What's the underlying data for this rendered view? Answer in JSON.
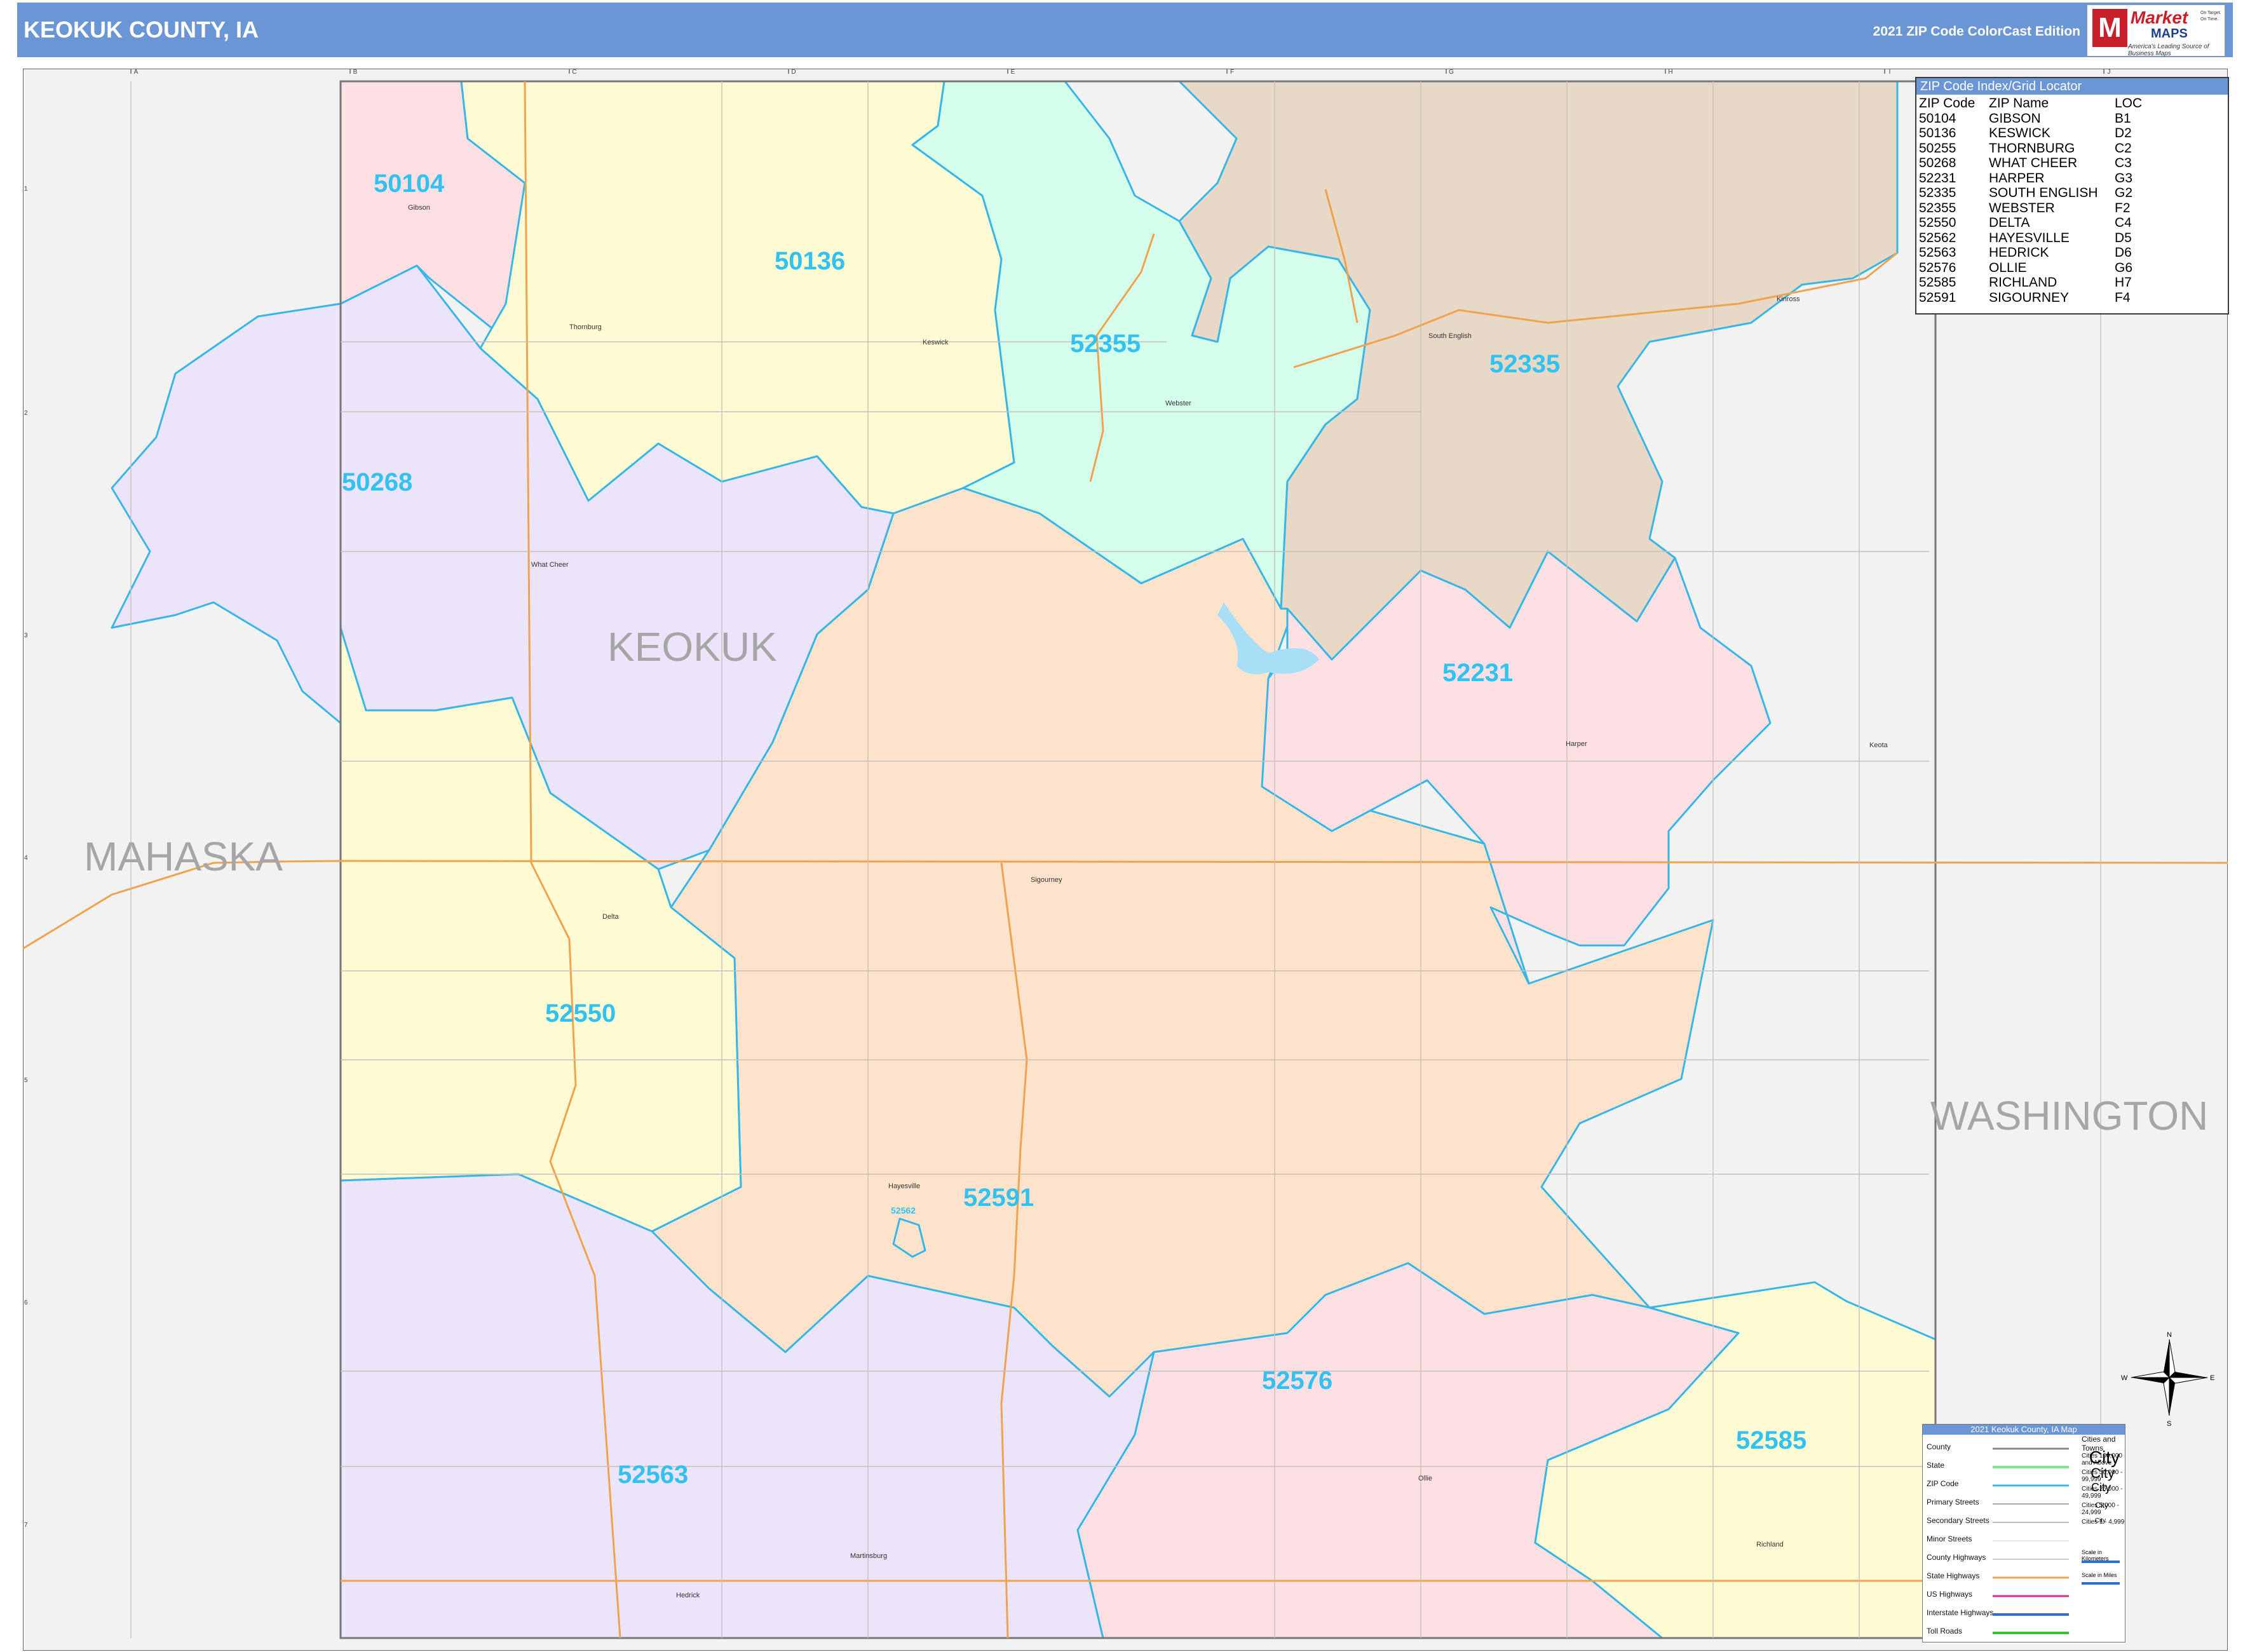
{
  "header": {
    "title": "KEOKUK COUNTY, IA",
    "edition": "2021 ZIP Code ColorCast Edition"
  },
  "logo": {
    "brand_line1": "Market",
    "brand_line2": "MAPS",
    "tagline": "America's Leading Source of Business Maps",
    "slogan": "On Target. On Time."
  },
  "county_labels": {
    "keokuk": "KEOKUK",
    "mahaska": "MAHASKA",
    "washington": "WASHINGTON"
  },
  "zip_labels": [
    "50104",
    "50136",
    "52355",
    "52335",
    "50268",
    "52231",
    "52550",
    "52591",
    "52576",
    "52585",
    "52563",
    "52562"
  ],
  "towns": [
    "Gibson",
    "Thornburg",
    "Keswick",
    "Webster",
    "South English",
    "Kinross",
    "What Cheer",
    "Harper",
    "Keota",
    "Sigourney",
    "Delta",
    "Hayesville",
    "Ollie",
    "Richland",
    "Hedrick",
    "Martinsburg"
  ],
  "grid": {
    "columns": [
      "A",
      "B",
      "C",
      "D",
      "E",
      "F",
      "G",
      "H",
      "I",
      "J"
    ],
    "rows": [
      "1",
      "2",
      "3",
      "4",
      "5",
      "6",
      "7"
    ]
  },
  "index": {
    "heading": "ZIP Code Index/Grid Locator",
    "columns": [
      "ZIP Code",
      "ZIP Name",
      "LOC"
    ],
    "rows": [
      [
        "50104",
        "GIBSON",
        "B1"
      ],
      [
        "50136",
        "KESWICK",
        "D2"
      ],
      [
        "50255",
        "THORNBURG",
        "C2"
      ],
      [
        "50268",
        "WHAT CHEER",
        "C3"
      ],
      [
        "52231",
        "HARPER",
        "G3"
      ],
      [
        "52335",
        "SOUTH ENGLISH",
        "G2"
      ],
      [
        "52355",
        "WEBSTER",
        "F2"
      ],
      [
        "52550",
        "DELTA",
        "C4"
      ],
      [
        "52562",
        "HAYESVILLE",
        "D5"
      ],
      [
        "52563",
        "HEDRICK",
        "D6"
      ],
      [
        "52576",
        "OLLIE",
        "G6"
      ],
      [
        "52585",
        "RICHLAND",
        "H7"
      ],
      [
        "52591",
        "SIGOURNEY",
        "F4"
      ]
    ]
  },
  "compass": {
    "n": "N",
    "s": "S",
    "e": "E",
    "w": "W"
  },
  "map_key": {
    "heading": "2021 Keokuk County, IA Map",
    "items": [
      "County",
      "State",
      "ZIP Code",
      "Primary Streets",
      "Secondary Streets",
      "Minor Streets",
      "County Highways",
      "State Highways",
      "US Highways",
      "Interstate Highways",
      "Toll Roads"
    ],
    "cities_heading": "Cities and Towns",
    "city_classes": [
      "Cities 100,000 and Above",
      "Cities 50,000 - 99,999",
      "Cities 25,000 - 49,999",
      "Cities 5,000 - 24,999",
      "Cities 1 - 4,999"
    ],
    "city_samples": [
      "City",
      "City",
      "City",
      "City",
      "City"
    ],
    "scale_km": "Scale in Kilometers",
    "scale_mi": "Scale in Miles"
  },
  "colors": {
    "header": "#6b96d6",
    "zip_text": "#33c1ef",
    "zip_border": "#38b6e6",
    "peach": "#fde3cc",
    "yellow": "#fefbd4",
    "pink": "#fde0e3",
    "lavender": "#ece4fb",
    "mint": "#d5fdec",
    "tan": "#e8d8c8",
    "grey": "#f2f2f2",
    "road_orange": "#f0a24d"
  }
}
